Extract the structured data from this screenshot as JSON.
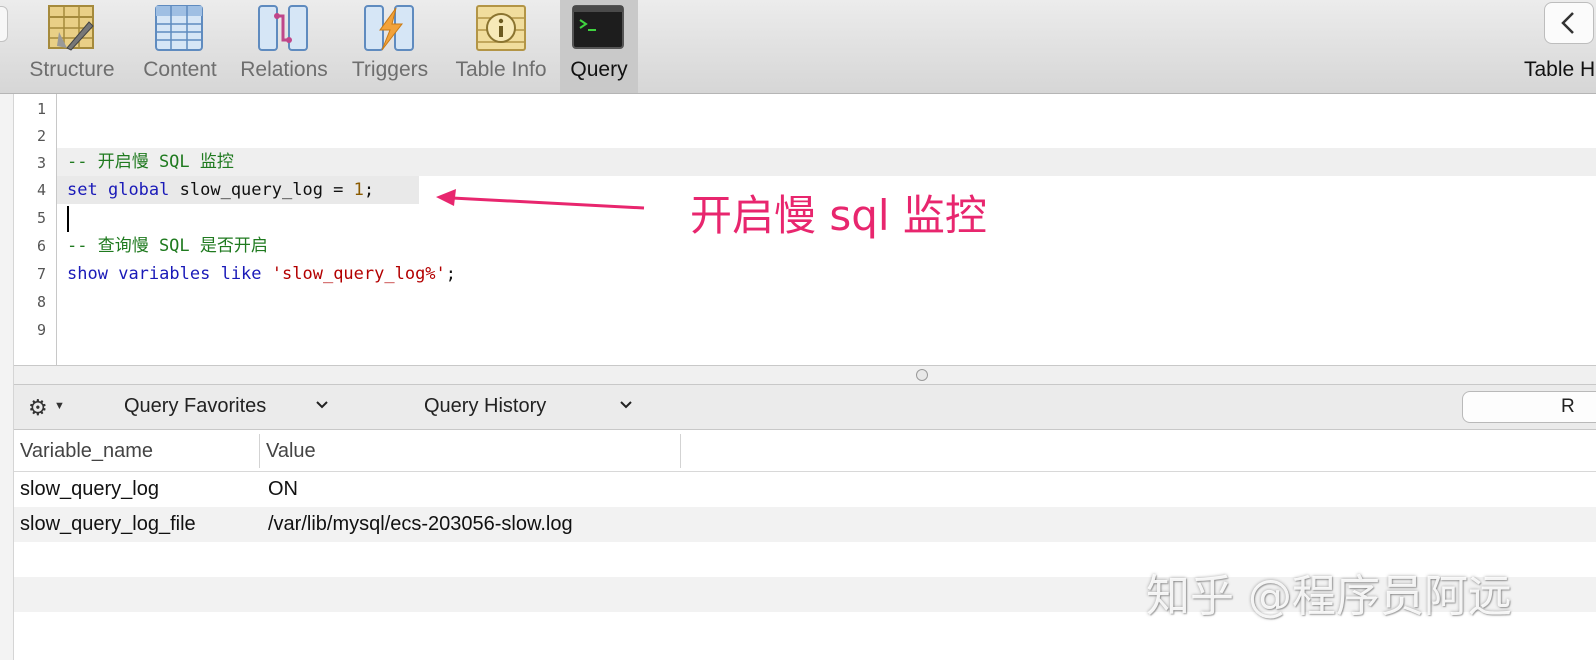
{
  "toolbar": {
    "tabs": [
      {
        "label": "Structure",
        "icon": "structure-icon"
      },
      {
        "label": "Content",
        "icon": "content-icon"
      },
      {
        "label": "Relations",
        "icon": "relations-icon"
      },
      {
        "label": "Triggers",
        "icon": "triggers-icon"
      },
      {
        "label": "Table Info",
        "icon": "table-info-icon"
      },
      {
        "label": "Query",
        "icon": "query-terminal-icon",
        "active": true
      }
    ],
    "right_label": "Table H"
  },
  "editor": {
    "line_numbers": [
      "1",
      "2",
      "3",
      "4",
      "5",
      "6",
      "7",
      "8",
      "9"
    ],
    "lines": {
      "l3_comment": "-- 开启慢 SQL 监控",
      "l4_kw1": "set",
      "l4_kw2": "global",
      "l4_var": "slow_query_log = ",
      "l4_num": "1",
      "l4_end": ";",
      "l6_comment": "-- 查询慢 SQL 是否开启",
      "l7_kw1": "show",
      "l7_kw2": "variables",
      "l7_kw3": "like",
      "l7_str": "'slow_query_log%'",
      "l7_end": ";"
    },
    "annotation": "开启慢 sql 监控"
  },
  "query_bar": {
    "favorites_label": "Query Favorites",
    "history_label": "Query History",
    "run_label": "R"
  },
  "results": {
    "columns": [
      "Variable_name",
      "Value"
    ],
    "rows": [
      {
        "name": "slow_query_log",
        "value": "ON"
      },
      {
        "name": "slow_query_log_file",
        "value": "/var/lib/mysql/ecs-203056-slow.log"
      }
    ]
  },
  "watermark": "知乎 @程序员阿远",
  "colors": {
    "keyword": "#1a1ab8",
    "comment": "#1f7a1f",
    "string": "#b30000",
    "annotation": "#e8266e"
  }
}
